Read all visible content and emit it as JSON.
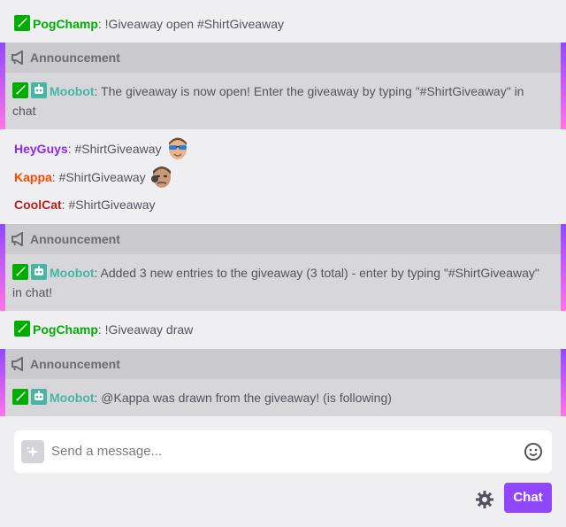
{
  "colors": {
    "moderator": "#00ad03",
    "moobot": "#45b6a3",
    "heyguys": "#8a2be2",
    "kappa": "#ff4500",
    "coolcat": "#b22222",
    "accent": "#9147ff",
    "announcement_gradient": [
      "#9147ff",
      "#ff75e6"
    ]
  },
  "messages": [
    {
      "type": "chat",
      "user": "PogChamp",
      "badges": [
        "sword-badge-icon"
      ],
      "text": ": !Giveaway open #ShirtGiveaway"
    },
    {
      "type": "announcement",
      "header": "Announcement",
      "user": "Moobot",
      "badges": [
        "sword-badge-icon",
        "robot-badge-icon"
      ],
      "text": ": The giveaway is now open! Enter the giveaway by typing \"#ShirtGiveaway\" in chat"
    },
    {
      "type": "chat",
      "user": "HeyGuys",
      "text": ": #ShirtGiveaway",
      "emote": "heyguys-emote-icon"
    },
    {
      "type": "chat",
      "user": "Kappa",
      "text": ": #ShirtGiveaway",
      "emote": "kappa-emote-icon"
    },
    {
      "type": "chat",
      "user": "CoolCat",
      "text": ": #ShirtGiveaway"
    },
    {
      "type": "announcement",
      "header": "Announcement",
      "user": "Moobot",
      "badges": [
        "sword-badge-icon",
        "robot-badge-icon"
      ],
      "text": ": Added 3 new entries to the giveaway (3 total) - enter by typing \"#ShirtGiveaway\" in chat!"
    },
    {
      "type": "chat",
      "user": "PogChamp",
      "badges": [
        "sword-badge-icon"
      ],
      "text": ": !Giveaway draw"
    },
    {
      "type": "announcement",
      "header": "Announcement",
      "user": "Moobot",
      "badges": [
        "sword-badge-icon",
        "robot-badge-icon"
      ],
      "text": ": @Kappa was drawn from the giveaway! (is following)"
    }
  ],
  "input": {
    "placeholder": "Send a message..."
  },
  "icons": {
    "sparkle": "sparkle-icon",
    "emoji": "emoji-icon",
    "settings": "gear-icon"
  },
  "chat_button": {
    "label": "Chat"
  }
}
